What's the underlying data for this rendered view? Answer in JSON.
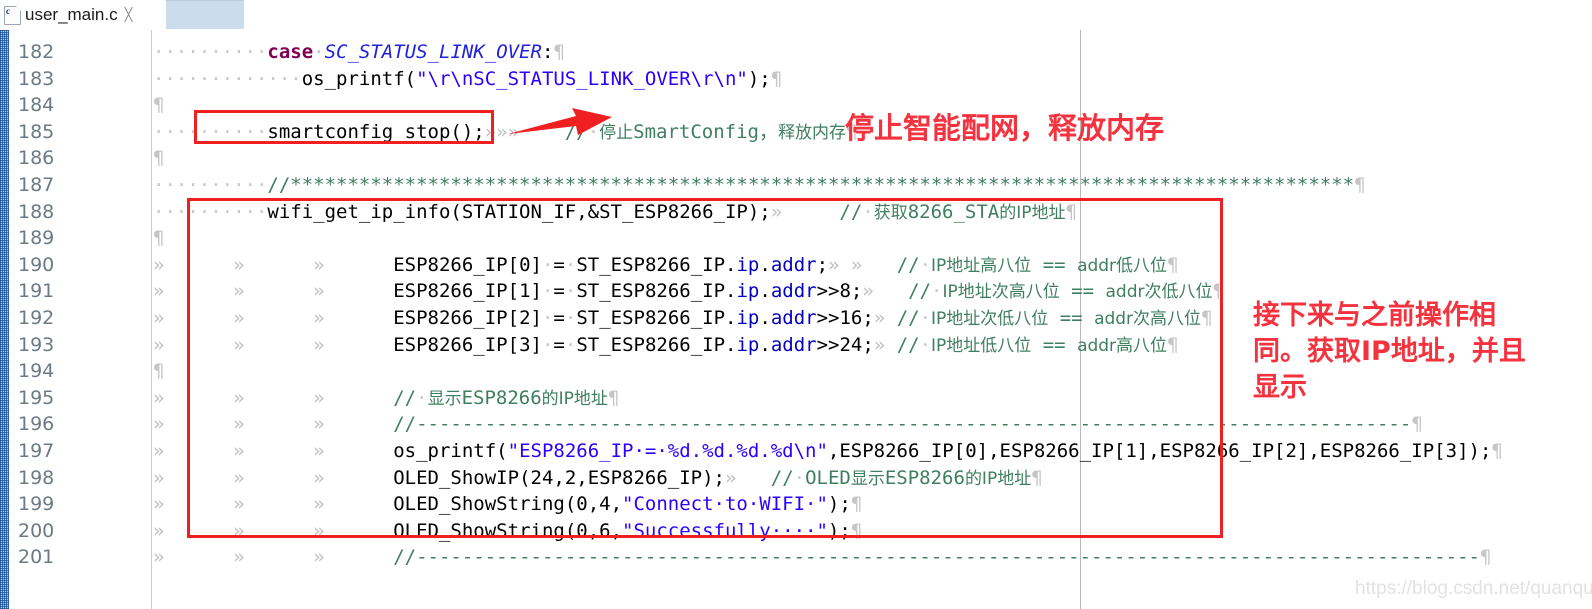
{
  "tab": {
    "filename": "user_main.c",
    "close_glyph": "╳",
    "icon": "c-file-icon"
  },
  "editor": {
    "pilcrow": "¶",
    "tab_marker": "»",
    "space_dot": "·",
    "margin_guide_x": 1080
  },
  "lines": [
    {
      "num": "182",
      "indent_dots": 10,
      "tabs": 0,
      "segs": [
        {
          "t": "kw",
          "v": "case"
        },
        {
          "t": "dot",
          "v": "·"
        },
        {
          "t": "macro",
          "v": "SC_STATUS_LINK_OVER"
        },
        {
          "t": "plain",
          "v": ":"
        },
        {
          "t": "pil",
          "v": "¶"
        }
      ]
    },
    {
      "num": "183",
      "indent_dots": 13,
      "tabs": 0,
      "segs": [
        {
          "t": "plain",
          "v": "os_printf("
        },
        {
          "t": "str",
          "v": "\"\\r\\nSC_STATUS_LINK_OVER\\r\\n\""
        },
        {
          "t": "plain",
          "v": ");"
        },
        {
          "t": "pil",
          "v": "¶"
        }
      ]
    },
    {
      "num": "184",
      "indent_dots": 0,
      "tabs": 0,
      "segs": [
        {
          "t": "pil",
          "v": "¶"
        }
      ]
    },
    {
      "num": "185",
      "indent_dots": 10,
      "tabs": 0,
      "segs": [
        {
          "t": "plain",
          "v": "smartconfig_stop();"
        },
        {
          "t": "tabm",
          "v": "»»»"
        },
        {
          "t": "plain",
          "v": "    "
        },
        {
          "t": "cmt",
          "v": "//"
        },
        {
          "t": "dot",
          "v": "·"
        },
        {
          "t": "cmt-cjk",
          "v": "停止"
        },
        {
          "t": "cmt",
          "v": "SmartConfig，"
        },
        {
          "t": "cmt-cjk",
          "v": "释放内存"
        },
        {
          "t": "pil",
          "v": "¶"
        }
      ]
    },
    {
      "num": "186",
      "indent_dots": 0,
      "tabs": 0,
      "segs": [
        {
          "t": "pil",
          "v": "¶"
        }
      ]
    },
    {
      "num": "187",
      "indent_dots": 10,
      "tabs": 0,
      "segs": [
        {
          "t": "cmt",
          "v": "//*********************************************************************************************"
        },
        {
          "t": "pil",
          "v": "¶"
        }
      ]
    },
    {
      "num": "188",
      "indent_dots": 10,
      "tabs": 0,
      "segs": [
        {
          "t": "plain",
          "v": "wifi_get_ip_info(STATION_IF,&ST_ESP8266_IP);"
        },
        {
          "t": "tabm",
          "v": "»"
        },
        {
          "t": "plain",
          "v": "     "
        },
        {
          "t": "cmt",
          "v": "//"
        },
        {
          "t": "dot",
          "v": "·"
        },
        {
          "t": "cmt-cjk",
          "v": "获取"
        },
        {
          "t": "cmt",
          "v": "8266_STA"
        },
        {
          "t": "cmt-cjk",
          "v": "的IP地址"
        },
        {
          "t": "pil",
          "v": "¶"
        }
      ]
    },
    {
      "num": "189",
      "indent_dots": 0,
      "tabs": 0,
      "segs": [
        {
          "t": "pil",
          "v": "¶"
        }
      ]
    },
    {
      "num": "190",
      "indent_dots": 0,
      "tabs": 3,
      "segs": [
        {
          "t": "plain",
          "v": "ESP8266_IP[0]"
        },
        {
          "t": "dot",
          "v": "·"
        },
        {
          "t": "plain",
          "v": "="
        },
        {
          "t": "dot",
          "v": "·"
        },
        {
          "t": "plain",
          "v": "ST_ESP8266_IP."
        },
        {
          "t": "fld",
          "v": "ip"
        },
        {
          "t": "plain",
          "v": "."
        },
        {
          "t": "fld",
          "v": "addr"
        },
        {
          "t": "plain",
          "v": ";"
        },
        {
          "t": "tabm",
          "v": "» »"
        },
        {
          "t": "plain",
          "v": "   "
        },
        {
          "t": "cmt",
          "v": "//"
        },
        {
          "t": "dot",
          "v": "·"
        },
        {
          "t": "cmt-cjk",
          "v": "IP地址高八位"
        },
        {
          "t": "cmt",
          "v": " == "
        },
        {
          "t": "cmt-cjk",
          "v": "addr低八位"
        },
        {
          "t": "pil",
          "v": "¶"
        }
      ]
    },
    {
      "num": "191",
      "indent_dots": 0,
      "tabs": 3,
      "segs": [
        {
          "t": "plain",
          "v": "ESP8266_IP[1]"
        },
        {
          "t": "dot",
          "v": "·"
        },
        {
          "t": "plain",
          "v": "="
        },
        {
          "t": "dot",
          "v": "·"
        },
        {
          "t": "plain",
          "v": "ST_ESP8266_IP."
        },
        {
          "t": "fld",
          "v": "ip"
        },
        {
          "t": "plain",
          "v": "."
        },
        {
          "t": "fld",
          "v": "addr"
        },
        {
          "t": "plain",
          "v": ">>8;"
        },
        {
          "t": "tabm",
          "v": "»"
        },
        {
          "t": "plain",
          "v": "   "
        },
        {
          "t": "cmt",
          "v": "//"
        },
        {
          "t": "dot",
          "v": "·"
        },
        {
          "t": "cmt-cjk",
          "v": "IP地址次高八位"
        },
        {
          "t": "cmt",
          "v": " == "
        },
        {
          "t": "cmt-cjk",
          "v": "addr次低八位"
        },
        {
          "t": "pil",
          "v": "¶"
        }
      ]
    },
    {
      "num": "192",
      "indent_dots": 0,
      "tabs": 3,
      "segs": [
        {
          "t": "plain",
          "v": "ESP8266_IP[2]"
        },
        {
          "t": "dot",
          "v": "·"
        },
        {
          "t": "plain",
          "v": "="
        },
        {
          "t": "dot",
          "v": "·"
        },
        {
          "t": "plain",
          "v": "ST_ESP8266_IP."
        },
        {
          "t": "fld",
          "v": "ip"
        },
        {
          "t": "plain",
          "v": "."
        },
        {
          "t": "fld",
          "v": "addr"
        },
        {
          "t": "plain",
          "v": ">>16;"
        },
        {
          "t": "tabm",
          "v": "»"
        },
        {
          "t": "plain",
          "v": " "
        },
        {
          "t": "cmt",
          "v": "//"
        },
        {
          "t": "dot",
          "v": "·"
        },
        {
          "t": "cmt-cjk",
          "v": "IP地址次低八位"
        },
        {
          "t": "cmt",
          "v": " == "
        },
        {
          "t": "cmt-cjk",
          "v": "addr次高八位"
        },
        {
          "t": "pil",
          "v": "¶"
        }
      ]
    },
    {
      "num": "193",
      "indent_dots": 0,
      "tabs": 3,
      "segs": [
        {
          "t": "plain",
          "v": "ESP8266_IP[3]"
        },
        {
          "t": "dot",
          "v": "·"
        },
        {
          "t": "plain",
          "v": "="
        },
        {
          "t": "dot",
          "v": "·"
        },
        {
          "t": "plain",
          "v": "ST_ESP8266_IP."
        },
        {
          "t": "fld",
          "v": "ip"
        },
        {
          "t": "plain",
          "v": "."
        },
        {
          "t": "fld",
          "v": "addr"
        },
        {
          "t": "plain",
          "v": ">>24;"
        },
        {
          "t": "tabm",
          "v": "»"
        },
        {
          "t": "plain",
          "v": " "
        },
        {
          "t": "cmt",
          "v": "//"
        },
        {
          "t": "dot",
          "v": "·"
        },
        {
          "t": "cmt-cjk",
          "v": "IP地址低八位"
        },
        {
          "t": "cmt",
          "v": " == "
        },
        {
          "t": "cmt-cjk",
          "v": "addr高八位"
        },
        {
          "t": "pil",
          "v": "¶"
        }
      ]
    },
    {
      "num": "194",
      "indent_dots": 0,
      "tabs": 0,
      "segs": [
        {
          "t": "pil",
          "v": "¶"
        }
      ]
    },
    {
      "num": "195",
      "indent_dots": 0,
      "tabs": 3,
      "segs": [
        {
          "t": "cmt",
          "v": "//"
        },
        {
          "t": "dot",
          "v": "·"
        },
        {
          "t": "cmt-cjk",
          "v": "显示"
        },
        {
          "t": "cmt",
          "v": "ESP8266"
        },
        {
          "t": "cmt-cjk",
          "v": "的IP地址"
        },
        {
          "t": "pil",
          "v": "¶"
        }
      ]
    },
    {
      "num": "196",
      "indent_dots": 0,
      "tabs": 3,
      "segs": [
        {
          "t": "cmt",
          "v": "//---------------------------------------------------------------------------------------"
        },
        {
          "t": "pil",
          "v": "¶"
        }
      ]
    },
    {
      "num": "197",
      "indent_dots": 0,
      "tabs": 3,
      "segs": [
        {
          "t": "plain",
          "v": "os_printf("
        },
        {
          "t": "str",
          "v": "\"ESP8266_IP·=·%d.%d.%d.%d\\n\""
        },
        {
          "t": "plain",
          "v": ",ESP8266_IP[0],ESP8266_IP[1],ESP8266_IP[2],ESP8266_IP[3]);"
        },
        {
          "t": "pil",
          "v": "¶"
        }
      ]
    },
    {
      "num": "198",
      "indent_dots": 0,
      "tabs": 3,
      "segs": [
        {
          "t": "plain",
          "v": "OLED_ShowIP(24,2,ESP8266_IP);"
        },
        {
          "t": "tabm",
          "v": "»"
        },
        {
          "t": "plain",
          "v": "   "
        },
        {
          "t": "cmt",
          "v": "//"
        },
        {
          "t": "dot",
          "v": "·"
        },
        {
          "t": "cmt",
          "v": "OLED"
        },
        {
          "t": "cmt-cjk",
          "v": "显示"
        },
        {
          "t": "cmt",
          "v": "ESP8266"
        },
        {
          "t": "cmt-cjk",
          "v": "的IP地址"
        },
        {
          "t": "pil",
          "v": "¶"
        }
      ]
    },
    {
      "num": "199",
      "indent_dots": 0,
      "tabs": 3,
      "segs": [
        {
          "t": "plain",
          "v": "OLED_ShowString(0,4,"
        },
        {
          "t": "str",
          "v": "\"Connect·to·WIFI·\""
        },
        {
          "t": "plain",
          "v": ");"
        },
        {
          "t": "pil",
          "v": "¶"
        }
      ]
    },
    {
      "num": "200",
      "indent_dots": 0,
      "tabs": 3,
      "segs": [
        {
          "t": "plain",
          "v": "OLED_ShowString(0,6,"
        },
        {
          "t": "str",
          "v": "\"Successfully····\""
        },
        {
          "t": "plain",
          "v": ");"
        },
        {
          "t": "pil",
          "v": "¶"
        }
      ]
    },
    {
      "num": "201",
      "indent_dots": 0,
      "tabs": 3,
      "segs": [
        {
          "t": "cmt",
          "v": "//---------------------------------------------------------------------------------------------"
        },
        {
          "t": "pil",
          "v": "¶"
        }
      ]
    }
  ],
  "annotations": {
    "box_stop": {
      "label": "smartconfig-stop-highlight"
    },
    "box_ip": {
      "label": "ip-block-highlight"
    },
    "arrow": {
      "label": "red-arrow-pointing-to-comment"
    },
    "note_top": "停止智能配网，释放内存",
    "note_right": [
      "接下来与之前操作相",
      "同。获取IP地址，并且",
      "显示"
    ]
  },
  "watermark": "https://blog.csdn.net/quanqueen",
  "colors": {
    "keyword": "#7f0055",
    "macro": "#2121e0",
    "string": "#2a00ff",
    "comment": "#3f7f5f",
    "annotation_red": "#f5333f",
    "box_red": "#f02020",
    "tab_fill": "#cbdced"
  }
}
